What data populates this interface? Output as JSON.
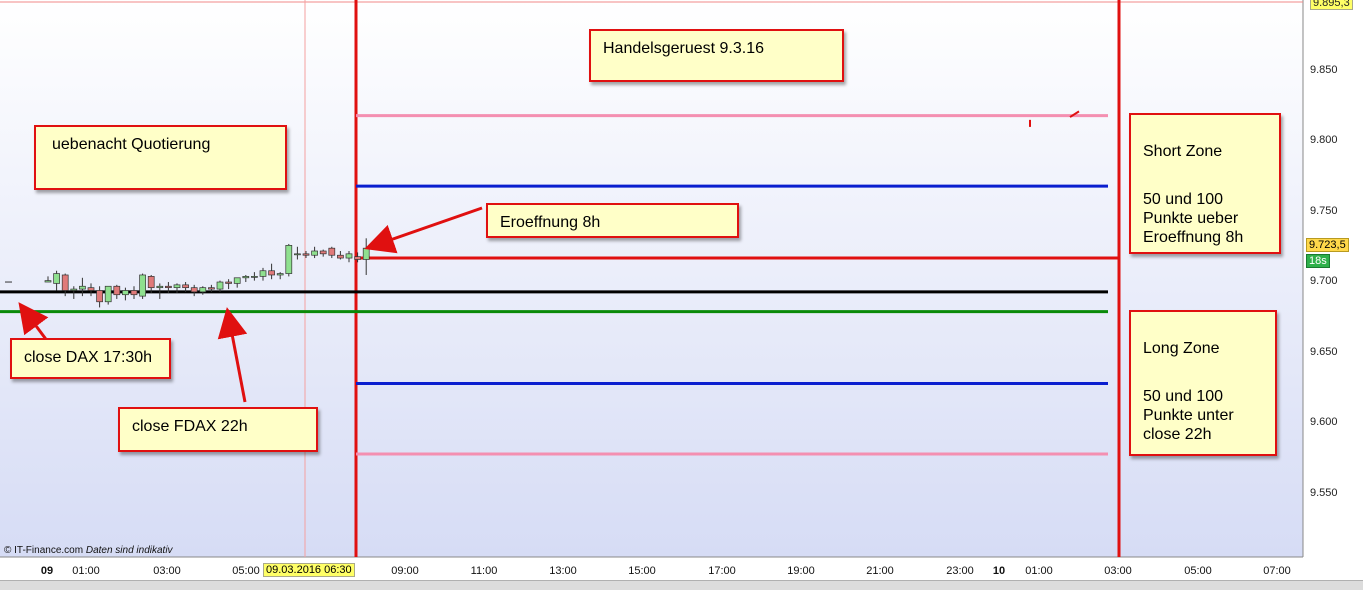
{
  "chart_data": {
    "type": "candlestick",
    "instrument_dates": {
      "date_marker": "09.03.2016 06:30"
    },
    "y_ticks": [
      "9.850",
      "9.800",
      "9.750",
      "9.700",
      "9.650",
      "9.600",
      "9.550"
    ],
    "y_top_label": "9.895,3",
    "current_price": "9.723,5",
    "timer": "18s",
    "x_ticks": [
      {
        "label": "09",
        "bold": true
      },
      {
        "label": "01:00"
      },
      {
        "label": "03:00"
      },
      {
        "label": "05:00"
      },
      {
        "label": "09:00"
      },
      {
        "label": "11:00"
      },
      {
        "label": "13:00"
      },
      {
        "label": "15:00"
      },
      {
        "label": "17:00"
      },
      {
        "label": "19:00"
      },
      {
        "label": "21:00"
      },
      {
        "label": "23:00"
      },
      {
        "label": "10",
        "bold": true
      },
      {
        "label": "01:00"
      },
      {
        "label": "03:00"
      },
      {
        "label": "05:00"
      },
      {
        "label": "07:00"
      }
    ],
    "ylim": [
      9505,
      9900
    ],
    "levels": [
      {
        "name": "short-100",
        "value": 9818,
        "color": "#f48fb1"
      },
      {
        "name": "short-50",
        "value": 9768,
        "color": "#0a1ecf"
      },
      {
        "name": "opening",
        "value": 9717,
        "color": "#e01010"
      },
      {
        "name": "close-dax",
        "value": 9693,
        "color": "#000000"
      },
      {
        "name": "close-fdax",
        "value": 9679,
        "color": "#0a8a0a"
      },
      {
        "name": "long-50",
        "value": 9628,
        "color": "#0a1ecf"
      },
      {
        "name": "long-100",
        "value": 9578,
        "color": "#f48fb1"
      }
    ],
    "candles": [
      {
        "o": 9700,
        "h": 9704,
        "l": 9700,
        "c": 9701
      },
      {
        "o": 9699,
        "h": 9708,
        "l": 9694,
        "c": 9706
      },
      {
        "o": 9705,
        "h": 9706,
        "l": 9690,
        "c": 9694
      },
      {
        "o": 9694,
        "h": 9697,
        "l": 9688,
        "c": 9695
      },
      {
        "o": 9695,
        "h": 9703,
        "l": 9690,
        "c": 9697
      },
      {
        "o": 9696,
        "h": 9699,
        "l": 9690,
        "c": 9694
      },
      {
        "o": 9694,
        "h": 9697,
        "l": 9682,
        "c": 9686
      },
      {
        "o": 9686,
        "h": 9697,
        "l": 9684,
        "c": 9697
      },
      {
        "o": 9697,
        "h": 9698,
        "l": 9688,
        "c": 9691
      },
      {
        "o": 9691,
        "h": 9696,
        "l": 9687,
        "c": 9694
      },
      {
        "o": 9694,
        "h": 9697,
        "l": 9688,
        "c": 9691
      },
      {
        "o": 9690,
        "h": 9706,
        "l": 9688,
        "c": 9705
      },
      {
        "o": 9704,
        "h": 9705,
        "l": 9692,
        "c": 9696
      },
      {
        "o": 9696,
        "h": 9699,
        "l": 9688,
        "c": 9697
      },
      {
        "o": 9697,
        "h": 9700,
        "l": 9692,
        "c": 9696
      },
      {
        "o": 9696,
        "h": 9699,
        "l": 9692,
        "c": 9698
      },
      {
        "o": 9698,
        "h": 9700,
        "l": 9693,
        "c": 9696
      },
      {
        "o": 9696,
        "h": 9698,
        "l": 9690,
        "c": 9693
      },
      {
        "o": 9693,
        "h": 9697,
        "l": 9691,
        "c": 9696
      },
      {
        "o": 9696,
        "h": 9698,
        "l": 9693,
        "c": 9695
      },
      {
        "o": 9695,
        "h": 9701,
        "l": 9693,
        "c": 9700
      },
      {
        "o": 9700,
        "h": 9702,
        "l": 9695,
        "c": 9699
      },
      {
        "o": 9699,
        "h": 9703,
        "l": 9696,
        "c": 9703
      },
      {
        "o": 9703,
        "h": 9705,
        "l": 9700,
        "c": 9704
      },
      {
        "o": 9704,
        "h": 9707,
        "l": 9701,
        "c": 9704
      },
      {
        "o": 9704,
        "h": 9710,
        "l": 9701,
        "c": 9708
      },
      {
        "o": 9708,
        "h": 9713,
        "l": 9702,
        "c": 9705
      },
      {
        "o": 9705,
        "h": 9707,
        "l": 9702,
        "c": 9706
      },
      {
        "o": 9706,
        "h": 9727,
        "l": 9704,
        "c": 9726
      },
      {
        "o": 9720,
        "h": 9725,
        "l": 9716,
        "c": 9720
      },
      {
        "o": 9720,
        "h": 9722,
        "l": 9717,
        "c": 9719
      },
      {
        "o": 9719,
        "h": 9725,
        "l": 9717,
        "c": 9722
      },
      {
        "o": 9722,
        "h": 9723,
        "l": 9718,
        "c": 9720
      },
      {
        "o": 9724,
        "h": 9725,
        "l": 9717,
        "c": 9719
      },
      {
        "o": 9719,
        "h": 9722,
        "l": 9716,
        "c": 9717
      },
      {
        "o": 9717,
        "h": 9722,
        "l": 9714,
        "c": 9720
      },
      {
        "o": 9718,
        "h": 9721,
        "l": 9714,
        "c": 9716
      },
      {
        "o": 9716,
        "h": 9731,
        "l": 9705,
        "c": 9724
      }
    ],
    "late_marks": [
      {
        "type": "tick",
        "value": 9815
      },
      {
        "type": "slash",
        "value": 9818
      }
    ],
    "footer": {
      "credit": "© IT-Finance.com",
      "note": "Daten sind indikativ"
    }
  },
  "notes": {
    "title": "Handelsgeruest 9.3.16",
    "overnight": "uebenacht Quotierung",
    "opening": "Eroeffnung 8h",
    "close_dax": "close DAX 17:30h",
    "close_fdax": "close FDAX 22h",
    "short_zone_title": "Short Zone",
    "short_zone_text": "50 und 100\nPunkte ueber\nEroeffnung 8h",
    "long_zone_title": "Long Zone",
    "long_zone_text": "50 und 100\nPunkte unter\nclose 22h"
  }
}
